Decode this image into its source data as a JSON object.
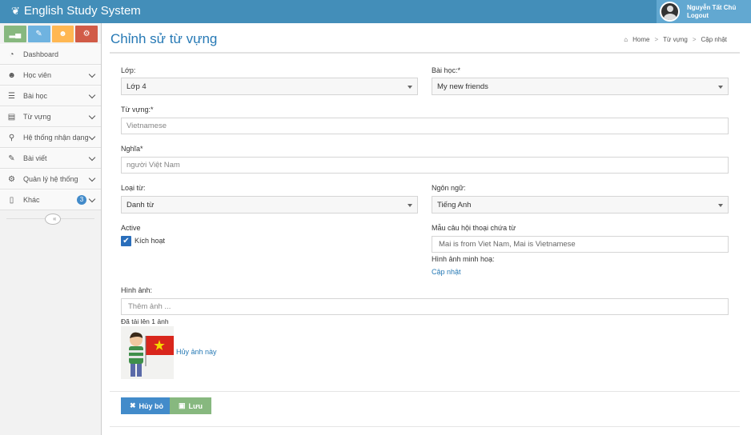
{
  "app": {
    "title": "English Study System"
  },
  "user": {
    "name": "Nguyễn Tất Chủ",
    "logout": "Logout"
  },
  "sidebar": {
    "shortcuts": [
      {
        "icon": "signal-icon"
      },
      {
        "icon": "pencil-icon"
      },
      {
        "icon": "users-icon"
      },
      {
        "icon": "cogs-icon"
      }
    ],
    "items": [
      {
        "label": "Dashboard",
        "icon": "tachometer-icon"
      },
      {
        "label": "Học viên",
        "icon": "users-icon"
      },
      {
        "label": "Bài học",
        "icon": "list-icon"
      },
      {
        "label": "Từ vựng",
        "icon": "file-icon"
      },
      {
        "label": "Hệ thống nhận dạng",
        "icon": "search-icon"
      },
      {
        "label": "Bài viết",
        "icon": "edit-icon"
      },
      {
        "label": "Quản lý hệ thống",
        "icon": "cogs-icon"
      },
      {
        "label": "Khác",
        "icon": "file-o-icon",
        "badge": "3"
      }
    ]
  },
  "page": {
    "title": "Chỉnh sử từ vựng",
    "breadcrumb": {
      "home": "Home",
      "level1": "Từ vựng",
      "level2": "Cập nhật"
    }
  },
  "form": {
    "lop": {
      "label": "Lớp:",
      "value": "Lớp 4"
    },
    "baihoc": {
      "label": "Bài học:*",
      "value": "My new friends"
    },
    "tuvung": {
      "label": "Từ vựng:*",
      "value": "Vietnamese"
    },
    "nghia": {
      "label": "Nghĩa*",
      "value": "người Việt Nam"
    },
    "loaitu": {
      "label": "Loại từ:",
      "value": "Danh từ"
    },
    "ngonngu": {
      "label": "Ngôn ngữ:",
      "value": "Tiếng Anh"
    },
    "active": {
      "label": "Active",
      "checkbox_label": "Kích hoạt",
      "checked": true
    },
    "maucau": {
      "label": "Mẫu câu hội thoại chứa từ",
      "value": "Mai is from Viet Nam, Mai is Vietnamese"
    },
    "hinhanhminhhoa": {
      "label": "Hình ảnh minh hoạ:",
      "link": "Cập nhật"
    },
    "hinhanh": {
      "label": "Hình ảnh:",
      "placeholder": "Thêm ảnh ...",
      "uploaded": "Đã tải lên 1 ảnh",
      "remove": "Hủy ảnh này"
    }
  },
  "buttons": {
    "cancel": "Hủy bỏ",
    "save": "Lưu"
  },
  "colors": {
    "navbar": "#438eb9",
    "title": "#2679b5",
    "cancel": "#428bca",
    "save": "#87b87f"
  }
}
